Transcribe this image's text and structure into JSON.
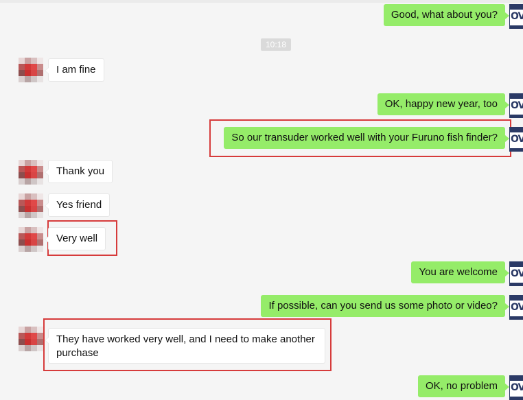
{
  "timestamp": "10:18",
  "messages": [
    {
      "side": "out",
      "text": "Good, what about you?"
    },
    {
      "side": "in",
      "text": "I am fine"
    },
    {
      "side": "out",
      "text": "OK, happy new year, too"
    },
    {
      "side": "out",
      "text": "So our transuder worked well with your Furuno fish finder?",
      "highlighted": true
    },
    {
      "side": "in",
      "text": "Thank you"
    },
    {
      "side": "in",
      "text": "Yes friend"
    },
    {
      "side": "in",
      "text": "Very well",
      "highlighted": true
    },
    {
      "side": "out",
      "text": "You are welcome"
    },
    {
      "side": "out",
      "text": "If possible, can you send us some photo or video?"
    },
    {
      "side": "in",
      "text": "They have worked very well, and I need to make another purchase",
      "highlighted": true
    },
    {
      "side": "out",
      "text": "OK, no problem"
    }
  ],
  "colors": {
    "background": "#f5f5f5",
    "outgoing_bubble": "#95ec69",
    "incoming_bubble": "#ffffff",
    "highlight_border": "#d63b3b"
  },
  "icons": {
    "incoming_avatar": "pixelated-avatar-icon",
    "outgoing_avatar": "company-logo-avatar-icon"
  }
}
